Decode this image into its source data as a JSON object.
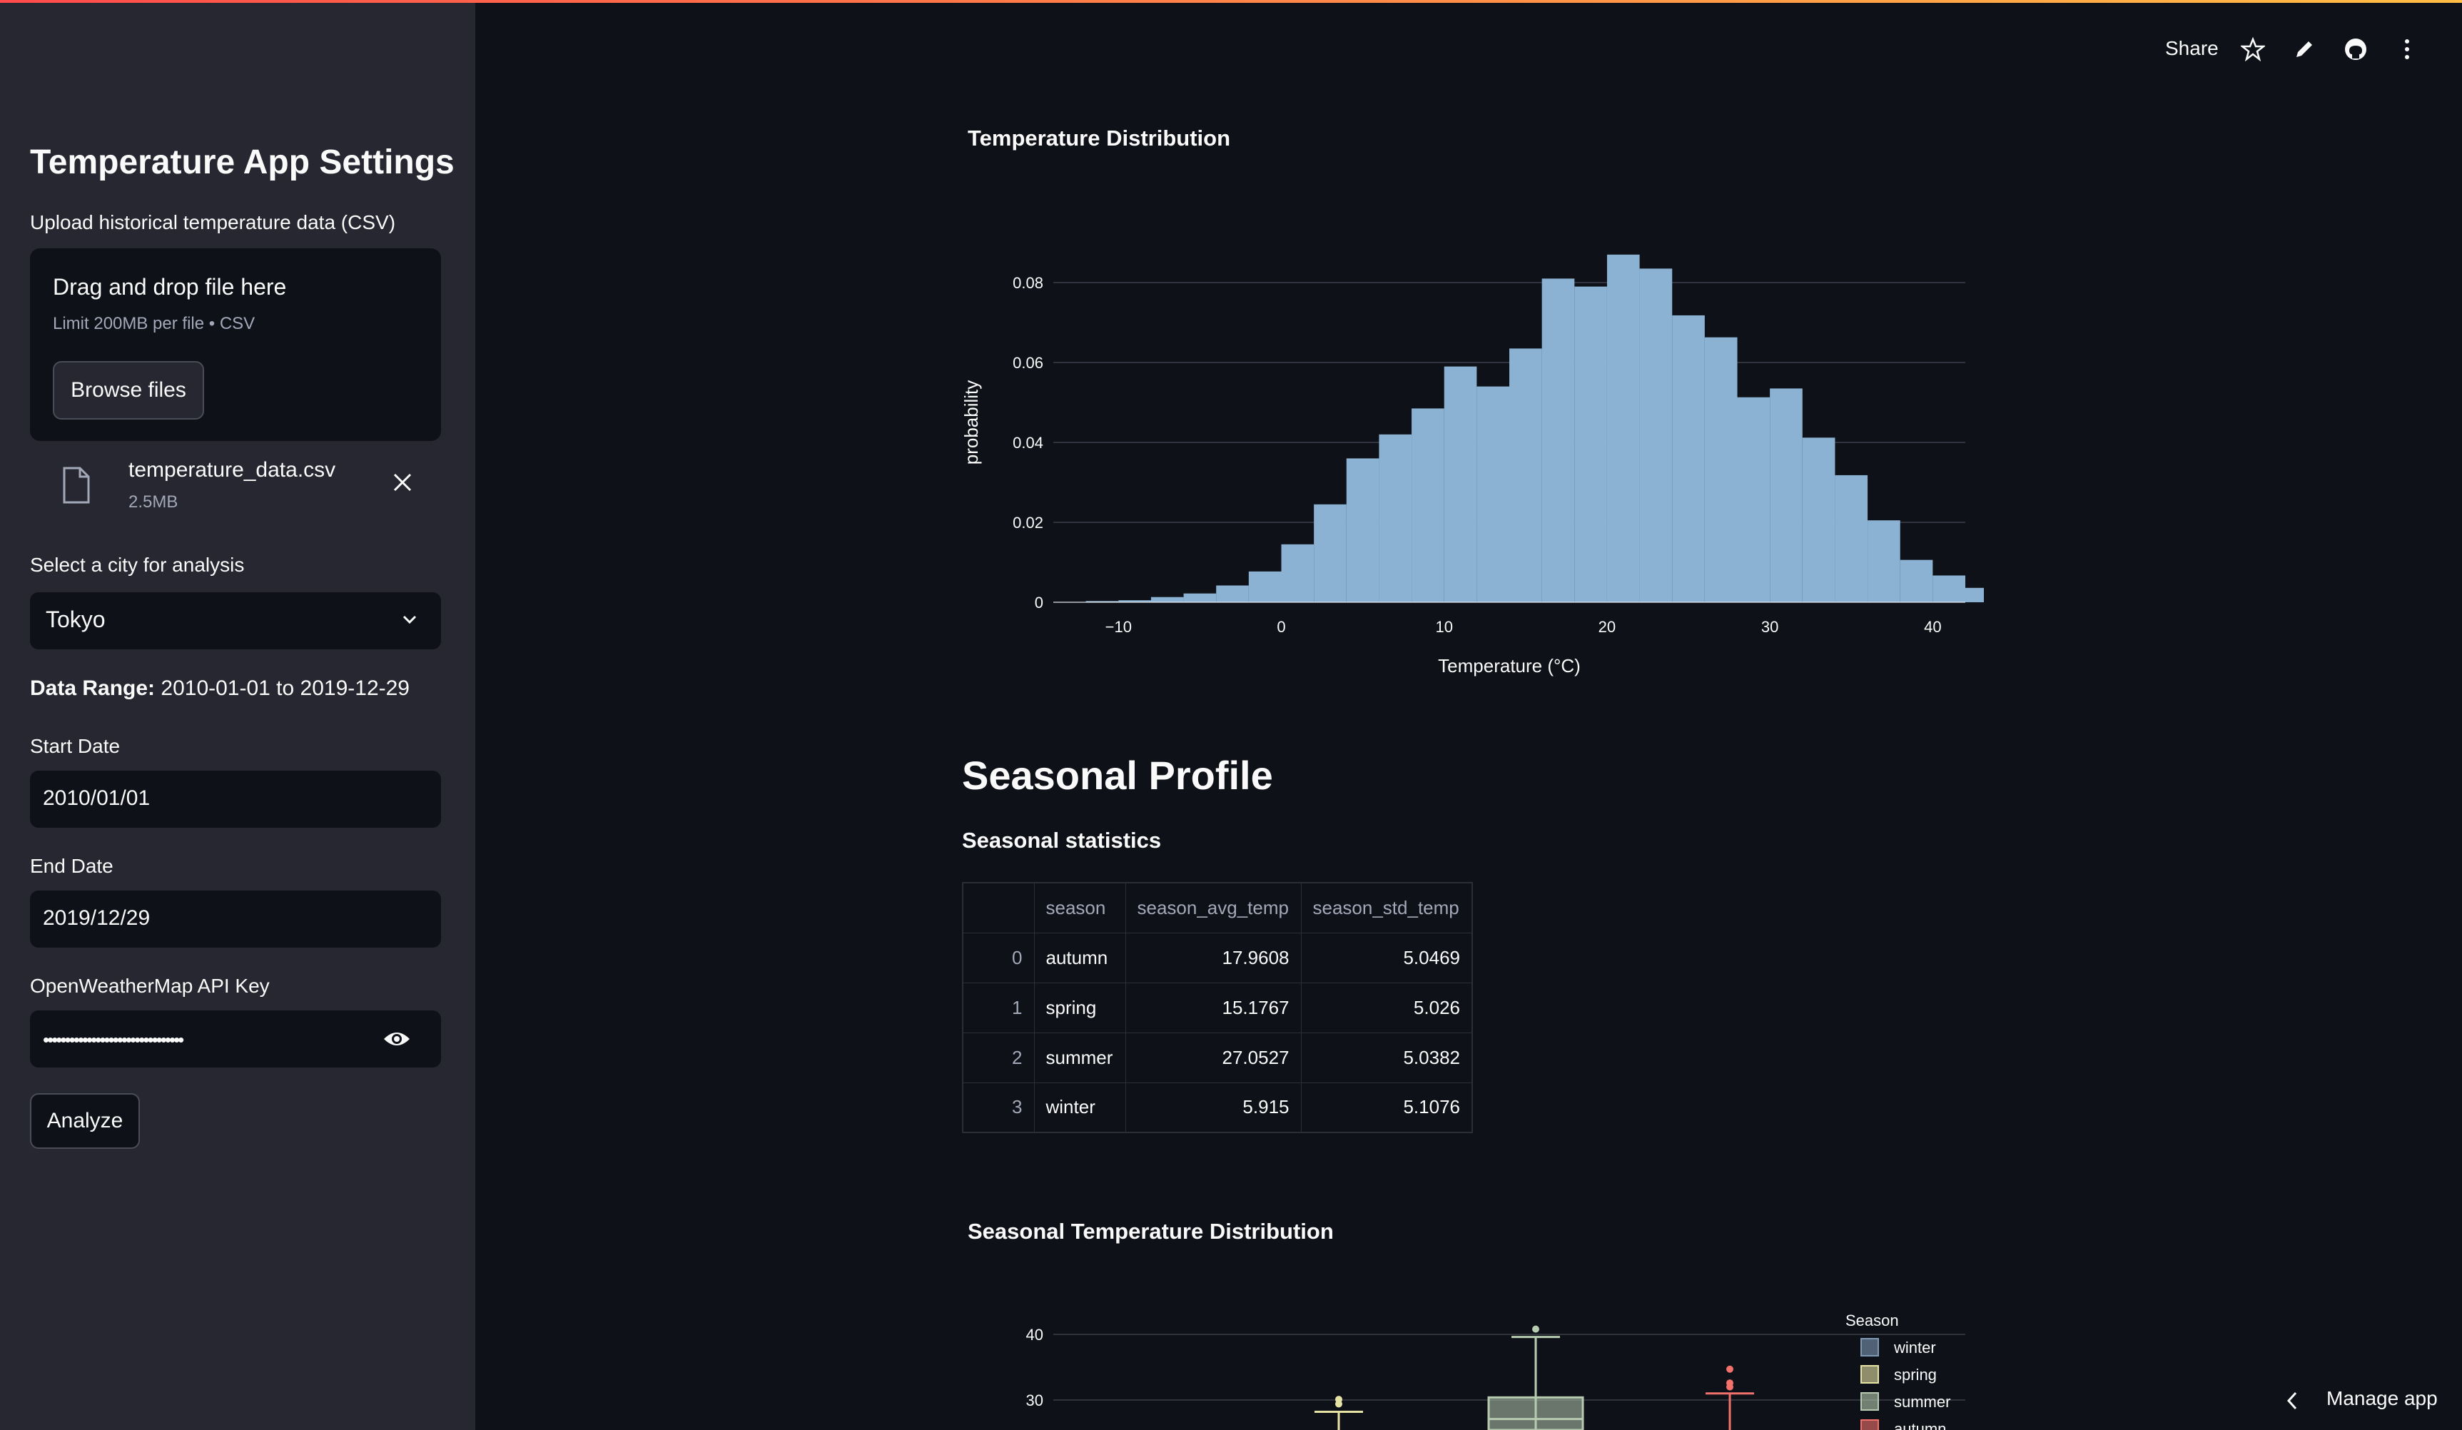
{
  "header": {
    "share_label": "Share",
    "icons": [
      "star-icon",
      "edit-icon",
      "github-icon",
      "more-icon"
    ]
  },
  "sidebar": {
    "title": "Temperature App Settings",
    "upload_label": "Upload historical temperature data (CSV)",
    "dropzone_text": "Drag and drop file here",
    "dropzone_limit": "Limit 200MB per file • CSV",
    "browse_label": "Browse files",
    "file_name": "temperature_data.csv",
    "file_size": "2.5MB",
    "city_label": "Select a city for analysis",
    "city_value": "Tokyo",
    "range_label": "Data Range:",
    "range_value": "2010-01-01 to 2019-12-29",
    "start_label": "Start Date",
    "start_value": "2010/01/01",
    "end_label": "End Date",
    "end_value": "2019/12/29",
    "api_label": "OpenWeatherMap API Key",
    "api_value": "••••••••••••••••••••••••••••••••",
    "analyze_label": "Analyze"
  },
  "main": {
    "hist_title": "Temperature Distribution",
    "seasonal_heading": "Seasonal Profile",
    "stats_heading": "Seasonal statistics",
    "box_title": "Seasonal Temperature Distribution",
    "manage_label": "Manage app"
  },
  "table": {
    "columns": [
      "",
      "season",
      "season_avg_temp",
      "season_std_temp"
    ],
    "rows": [
      [
        "0",
        "autumn",
        "17.9608",
        "5.0469"
      ],
      [
        "1",
        "spring",
        "15.1767",
        "5.026"
      ],
      [
        "2",
        "summer",
        "27.0527",
        "5.0382"
      ],
      [
        "3",
        "winter",
        "5.915",
        "5.1076"
      ]
    ]
  },
  "chart_data": [
    {
      "type": "bar",
      "title": "Temperature Distribution",
      "xlabel": "Temperature (°C)",
      "ylabel": "probability",
      "xlim": [
        -14,
        42
      ],
      "ylim": [
        0,
        0.09
      ],
      "xticks": [
        "−10",
        "0",
        "10",
        "20",
        "30",
        "40"
      ],
      "yticks": [
        "0",
        "0.02",
        "0.04",
        "0.06",
        "0.08"
      ],
      "bin_start": -12,
      "bin_width": 2,
      "values": [
        0.0003,
        0.0005,
        0.0013,
        0.0022,
        0.0042,
        0.0077,
        0.0145,
        0.0245,
        0.036,
        0.042,
        0.0485,
        0.059,
        0.054,
        0.0635,
        0.081,
        0.079,
        0.087,
        0.0835,
        0.0718,
        0.0663,
        0.0513,
        0.0535,
        0.0412,
        0.0318,
        0.0205,
        0.0106,
        0.0067,
        0.0036,
        0.0008
      ],
      "color": "#8cb2d3",
      "grid": true
    },
    {
      "type": "box",
      "title": "Seasonal Temperature Distribution",
      "legend_title": "Season",
      "legend": [
        {
          "name": "winter",
          "color": "#7f98b4"
        },
        {
          "name": "spring",
          "color": "#e6e3a5"
        },
        {
          "name": "summer",
          "color": "#b6cbb0"
        },
        {
          "name": "autumn",
          "color": "#f2716b"
        }
      ],
      "yticks": [
        "40",
        "30"
      ],
      "visible_series": [
        {
          "name": "spring",
          "whisker_high": 28.2,
          "outliers": [
            29.4,
            30.1
          ],
          "color": "#e6e3a5"
        },
        {
          "name": "summer",
          "whisker_high": 39.6,
          "q3": 30.4,
          "median": 27.1,
          "outliers": [
            40.8
          ],
          "color": "#b6cbb0"
        },
        {
          "name": "autumn",
          "whisker_high": 31.0,
          "outliers": [
            32.0,
            32.6,
            34.7
          ],
          "color": "#f2716b"
        }
      ],
      "legend_position": "top-right"
    }
  ]
}
